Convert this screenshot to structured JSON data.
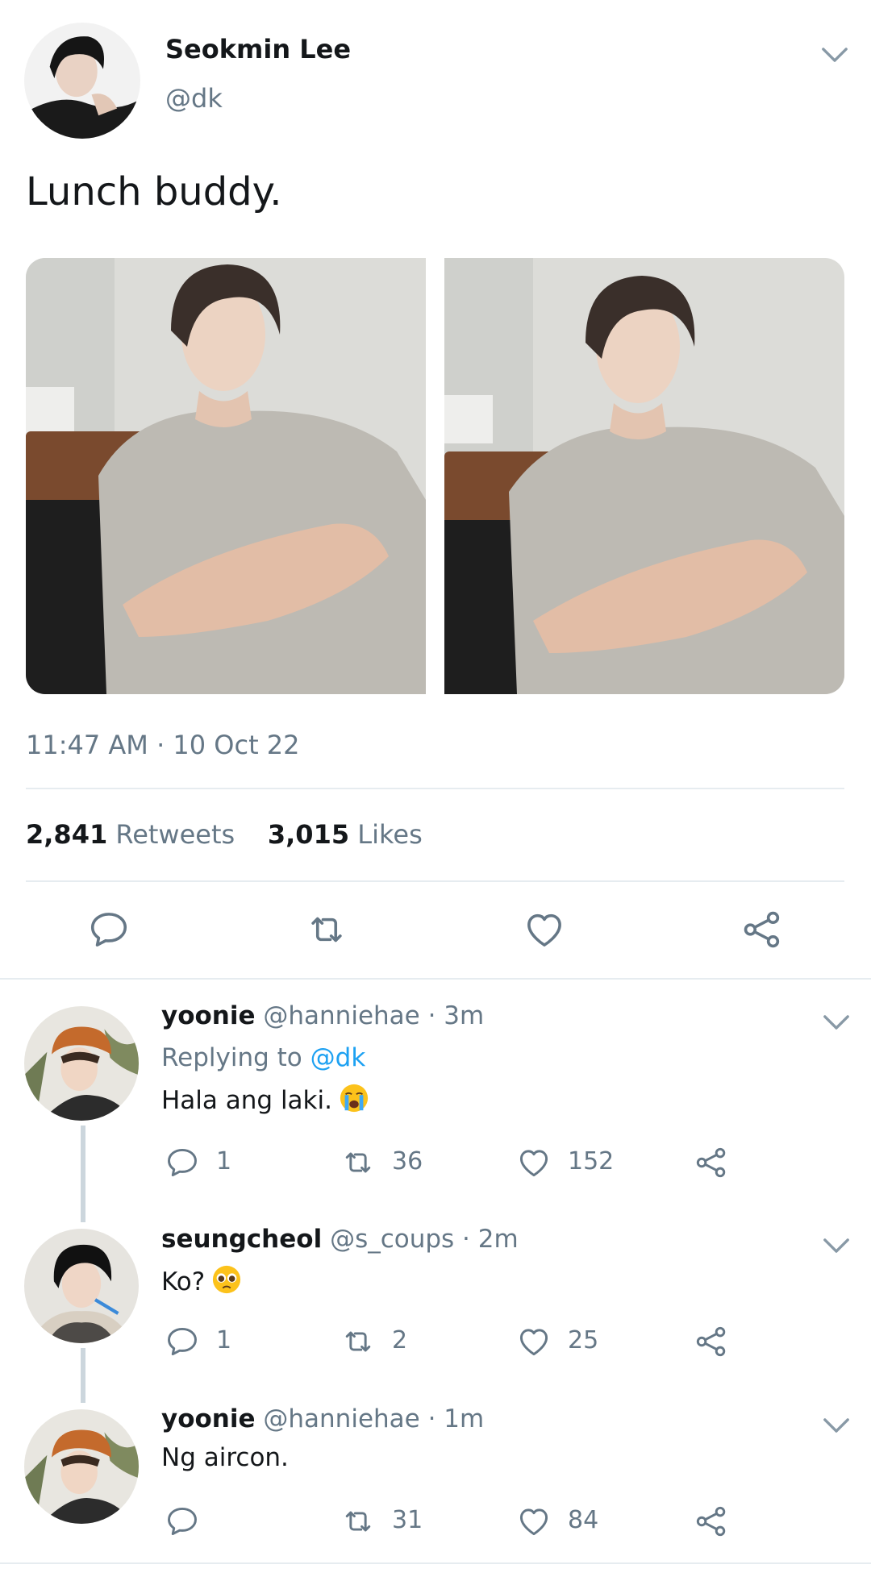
{
  "tweet": {
    "author_name": "Seokmin Lee",
    "author_handle": "@dk",
    "text": "Lunch buddy.",
    "timestamp": "11:47 AM · 10 Oct 22",
    "retweets_count": "2,841",
    "retweets_label": "Retweets",
    "likes_count": "3,015",
    "likes_label": "Likes",
    "icons": [
      "reply-icon",
      "retweet-icon",
      "like-icon",
      "share-icon"
    ]
  },
  "replies": [
    {
      "name": "yoonie",
      "meta": "@hanniehae · 3m",
      "replying_prefix": "Replying to",
      "replying_to": "@dk",
      "text": "Hala ang laki.",
      "emoji": "loudly-crying-face",
      "reply_count": "1",
      "retweet_count": "36",
      "like_count": "152"
    },
    {
      "name": "seungcheol",
      "meta": "@s_coups · 2m",
      "text": "Ko?",
      "emoji": "pleading-face",
      "reply_count": "1",
      "retweet_count": "2",
      "like_count": "25"
    },
    {
      "name": "yoonie",
      "meta": "@hanniehae · 1m",
      "text": "Ng aircon.",
      "reply_count": "",
      "retweet_count": "31",
      "like_count": "84"
    }
  ],
  "colors": {
    "text": "#14171a",
    "secondary": "#657786",
    "link": "#1da1f2",
    "divider": "#e6ecf0",
    "thread_line": "#ccd6dd"
  }
}
